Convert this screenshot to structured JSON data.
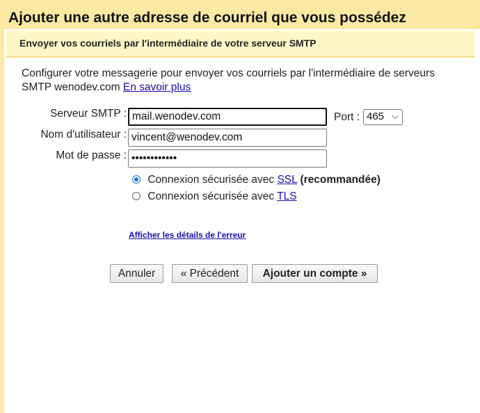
{
  "title": "Ajouter une autre adresse de courriel que vous possédez",
  "subheader": "Envoyer vos courriels par l'intermédiaire de votre serveur SMTP",
  "intro": {
    "text": "Configurer votre messagerie pour envoyer vos courriels par l'intermédiaire de serveurs SMTP wenodev.com",
    "learn_more": "En savoir plus"
  },
  "form": {
    "smtp_label": "Serveur SMTP :",
    "smtp_value": "mail.wenodev.com",
    "port_label": "Port :",
    "port_value": "465",
    "username_label": "Nom d'utilisateur :",
    "username_value": "vincent@wenodev.com",
    "password_label": "Mot de passe :",
    "password_value": "••••••••••••"
  },
  "security": {
    "ssl_prefix": "Connexion sécurisée avec",
    "ssl_link": "SSL",
    "ssl_suffix": "(recommandée)",
    "ssl_selected": true,
    "tls_prefix": "Connexion sécurisée avec",
    "tls_link": "TLS"
  },
  "error_link": "Afficher les détails de l'erreur",
  "buttons": {
    "cancel": "Annuler",
    "previous": "« Précédent",
    "add_account": "Ajouter un compte »"
  },
  "colors": {
    "header_background": "#fbe9a4",
    "link": "#1a0dab",
    "radio_accent": "#1a73e8"
  }
}
